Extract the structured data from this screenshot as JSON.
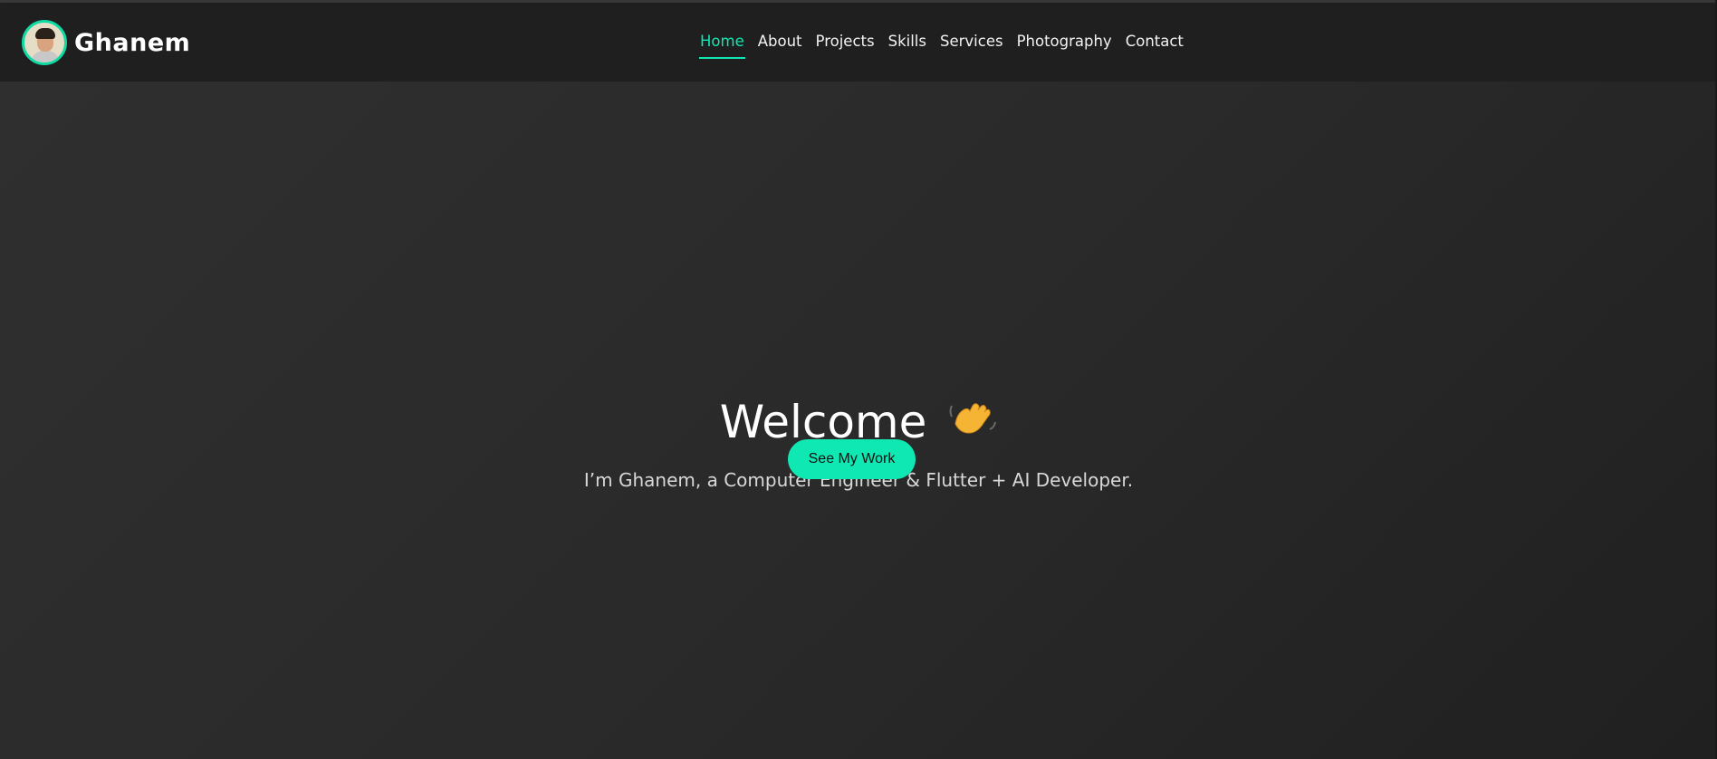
{
  "brand": {
    "name": "Ghanem"
  },
  "nav": {
    "items": [
      {
        "label": "Home",
        "active": true
      },
      {
        "label": "About"
      },
      {
        "label": "Projects"
      },
      {
        "label": "Skills"
      },
      {
        "label": "Services"
      },
      {
        "label": "Photography"
      },
      {
        "label": "Contact"
      }
    ]
  },
  "hero": {
    "title": "Welcome",
    "emoji_icon": "waving-hand-icon",
    "subtitle": "I’m Ghanem, a Computer Engineer & Flutter + AI Developer.",
    "cta_label": "See My Work"
  },
  "colors": {
    "accent": "#10e8b4",
    "navbar_bg": "#1f1f1f",
    "hero_bg": "#2a2a2a",
    "text": "#ffffff"
  }
}
